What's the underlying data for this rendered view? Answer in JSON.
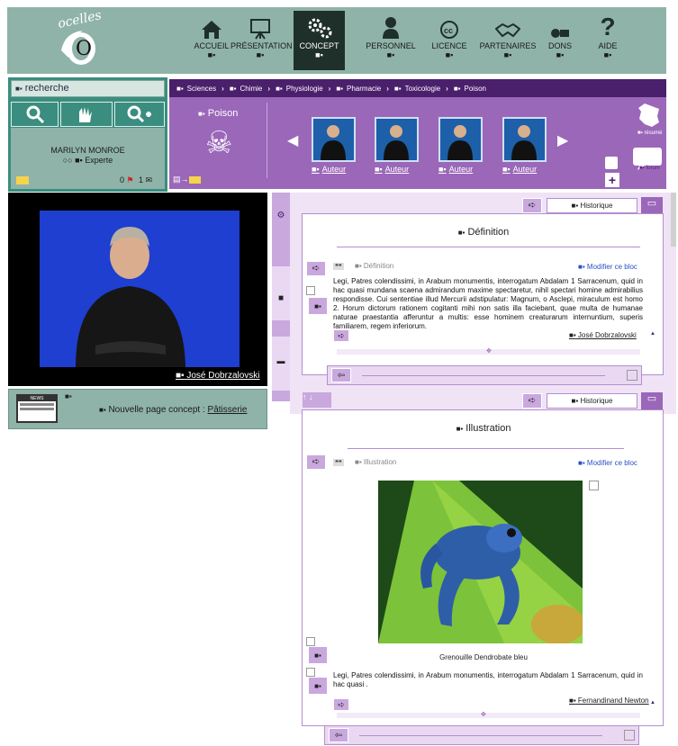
{
  "logo": {
    "text": "ocelles",
    "letter": "O"
  },
  "nav": [
    {
      "label": "ACCUEIL",
      "icon": "home-icon"
    },
    {
      "label": "PRÉSENTATION",
      "icon": "easel-icon"
    },
    {
      "label": "CONCEPT",
      "icon": "gears-icon",
      "active": true
    },
    {
      "label": "PERSONNEL",
      "icon": "person-icon"
    },
    {
      "label": "LICENCE",
      "icon": "cc-icon"
    },
    {
      "label": "PARTENAIRES",
      "icon": "handshake-icon"
    },
    {
      "label": "DONS",
      "icon": "donate-icon"
    },
    {
      "label": "AIDE",
      "icon": "help-icon"
    }
  ],
  "search": {
    "placeholder": "recherche"
  },
  "user": {
    "name": "MARILYN MONROE",
    "level": "Experte",
    "flags": "0",
    "messages": "1"
  },
  "breadcrumb": [
    "Sciences",
    "Chimie",
    "Physiologie",
    "Pharmacie",
    "Toxicologie",
    "Poison"
  ],
  "concept": {
    "title": "Poison"
  },
  "authors": [
    "Auteur",
    "Auteur",
    "Auteur",
    "Auteur"
  ],
  "side": {
    "resume": "résumé",
    "forum": "forum"
  },
  "video": {
    "credit": "José Dobrzalovski"
  },
  "news": {
    "prefix": "Nouvelle page concept :",
    "link": "Pâtisserie",
    "badge": "NEWS"
  },
  "definition": {
    "historique": "Historique",
    "title": "Définition",
    "sub": "Définition",
    "edit": "Modifier ce bloc",
    "text": "Legi, Patres colendissimi, in Arabum monumentis, interrogatum Abdalam 1  Sarracenum, quid in hac quasi mundana scaena admirandum maxime spectaretur, nihil spectari homine admirabilius respondisse. Cui sententiae illud Mercurii adstipulatur: Magnum, o Asclepi, miraculum est homo 2. Horum dictorum rationem cogitanti mihi non satis illa faciebant, quae multa de humanae naturae praestantia afferuntur a multis: esse hominem creaturarum internuntium, superis familiarem, regem inferiorum.",
    "author": "José Dobrzalovski"
  },
  "illustration": {
    "historique": "Historique",
    "title": "Illustration",
    "sub": "Illustration",
    "edit": "Modifier ce bloc",
    "caption": "Grenouille Dendrobate bleu",
    "text": "Legi, Patres colendissimi, in Arabum monumentis, interrogatum Abdalam 1  Sarracenum, quid in hac quasi .",
    "author": "Fernandinand Newton"
  },
  "colors": {
    "teal": "#8fb3a8",
    "purple": "#9b67b9",
    "darkpurple": "#4a1f6b",
    "lavender": "#c9a8de"
  }
}
